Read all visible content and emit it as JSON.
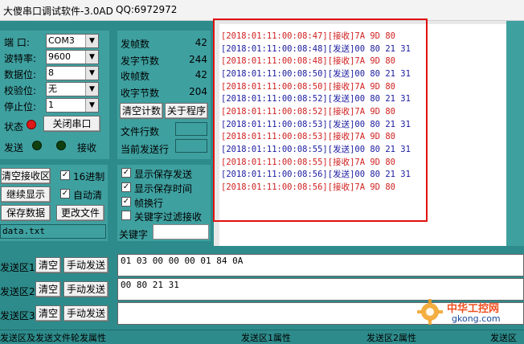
{
  "title": {
    "app": "大傻串口调试软件-3.0AD",
    "qq": "QQ:6972972"
  },
  "serial": {
    "port_label": "端  口:",
    "port_value": "COM3",
    "baud_label": "波特率:",
    "baud_value": "9600",
    "data_label": "数据位:",
    "data_value": "8",
    "parity_label": "校验位:",
    "parity_value": "无",
    "stop_label": "停止位:",
    "stop_value": "1",
    "status_label": "状态",
    "close_port_button": "关闭串口",
    "send_label": "发送",
    "recv_label": "接收"
  },
  "stats": {
    "sent_frames_label": "发帧数",
    "sent_frames_value": "42",
    "sent_bytes_label": "发字节数",
    "sent_bytes_value": "244",
    "recv_frames_label": "收帧数",
    "recv_frames_value": "42",
    "recv_bytes_label": "收字节数",
    "recv_bytes_value": "204",
    "clear_count_button": "清空计数",
    "about_button": "关于程序",
    "file_lines_label": "文件行数",
    "current_send_line_label": "当前发送行"
  },
  "receive_options": {
    "clear_recv_button": "清空接收区",
    "hex_label": "16进制",
    "hex_checked": "✓",
    "continue_button": "继续显示",
    "auto_clear_label": "自动清",
    "auto_clear_checked": "✓",
    "save_data_button": "保存数据",
    "change_file_button": "更改文件",
    "file_name": "data.txt"
  },
  "display_options": {
    "show_save_send_label": "显示保存发送",
    "show_save_send_checked": "✓",
    "show_save_time_label": "显示保存时间",
    "show_save_time_checked": "✓",
    "frame_newline_label": "帧换行",
    "frame_newline_checked": "✓",
    "keyword_filter_label": "关键字过滤接收",
    "keyword_filter_checked": "",
    "keyword_label": "关键字"
  },
  "log": [
    {
      "text": "[2018:01:11:00:08:47][接收]7A 9D 80",
      "type": "recv"
    },
    {
      "text": "[2018:01:11:00:08:48][发送]00 80 21 31",
      "type": "send"
    },
    {
      "text": "[2018:01:11:00:08:48][接收]7A 9D 80",
      "type": "recv"
    },
    {
      "text": "[2018:01:11:00:08:50][发送]00 80 21 31",
      "type": "send"
    },
    {
      "text": "[2018:01:11:00:08:50][接收]7A 9D 80",
      "type": "recv"
    },
    {
      "text": "[2018:01:11:00:08:52][发送]00 80 21 31",
      "type": "send"
    },
    {
      "text": "[2018:01:11:00:08:52][接收]7A 9D 80",
      "type": "recv"
    },
    {
      "text": "[2018:01:11:00:08:53][发送]00 80 21 31",
      "type": "send"
    },
    {
      "text": "[2018:01:11:00:08:53][接收]7A 9D 80",
      "type": "recv"
    },
    {
      "text": "[2018:01:11:00:08:55][发送]00 80 21 31",
      "type": "send"
    },
    {
      "text": "[2018:01:11:00:08:55][接收]7A 9D 80",
      "type": "recv"
    },
    {
      "text": "[2018:01:11:00:08:56][发送]00 80 21 31",
      "type": "send"
    },
    {
      "text": "[2018:01:11:00:08:56][接收]7A 9D 80",
      "type": "recv"
    }
  ],
  "send_areas": [
    {
      "label": "发送区1",
      "clear": "清空",
      "manual": "手动发送",
      "content": "01 03 00 00 00 01 84 0A"
    },
    {
      "label": "发送区2",
      "clear": "清空",
      "manual": "手动发送",
      "content": "00  80 21 31"
    },
    {
      "label": "发送区3",
      "clear": "清空",
      "manual": "手动发送",
      "content": ""
    }
  ],
  "bottom": {
    "col1": "发送区及发送文件轮发属性",
    "col2": "发送区1属性",
    "col3": "发送区2属性",
    "col4": "发送区"
  },
  "watermark": {
    "site": "中华工控网",
    "domain": "gkong.com"
  },
  "colors": {
    "background": "#2e8b8b",
    "panel": "#3fa0a0",
    "recv_text": "#d02020",
    "send_text": "#1a1aa0",
    "highlight_box": "#e01010",
    "led_red": "#e01818",
    "led_dark": "#104010"
  }
}
